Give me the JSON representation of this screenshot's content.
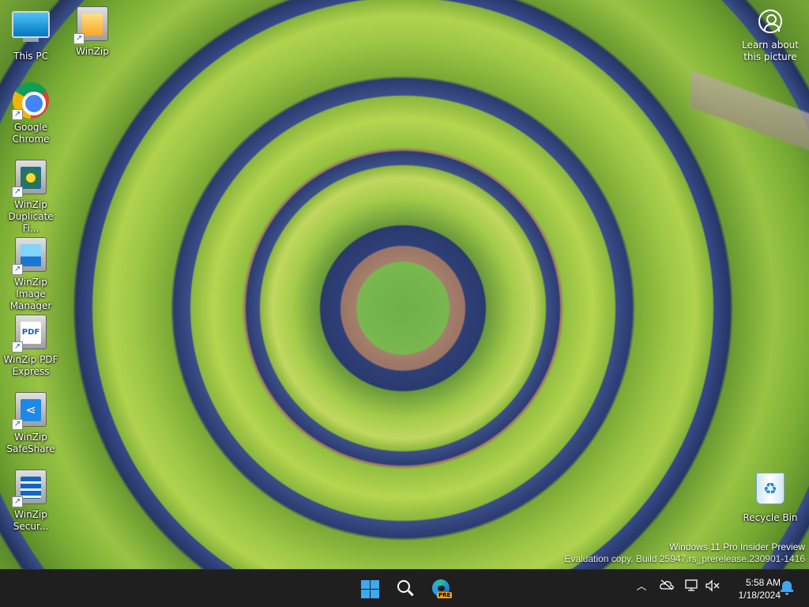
{
  "desktop": {
    "icons": [
      {
        "label": "This PC",
        "icon": "this-pc-icon"
      },
      {
        "label": "WinZip",
        "icon": "winzip-icon"
      },
      {
        "label": "Google Chrome",
        "icon": "chrome-icon"
      },
      {
        "label": "WinZip Duplicate Fi...",
        "icon": "winzip-duplicate-finder-icon"
      },
      {
        "label": "WinZip Image Manager",
        "icon": "winzip-image-manager-icon"
      },
      {
        "label": "WinZip PDF Express",
        "icon": "winzip-pdf-express-icon"
      },
      {
        "label": "WinZip SafeShare",
        "icon": "winzip-safeshare-icon"
      },
      {
        "label": "WinZip Secur...",
        "icon": "winzip-secure-backup-icon"
      },
      {
        "label": "Recycle Bin",
        "icon": "recycle-bin-icon"
      }
    ],
    "learn_about": {
      "line1": "Learn about",
      "line2": "this picture"
    },
    "watermark": {
      "line1": "Windows 11 Pro Insider Preview",
      "line2": "Evaluation copy. Build 25947.rs_prerelease.230901-1416"
    }
  },
  "taskbar": {
    "pinned": [
      {
        "name": "Start",
        "icon": "windows-start-icon"
      },
      {
        "name": "Search",
        "icon": "search-icon"
      },
      {
        "name": "Microsoft Edge",
        "icon": "edge-icon",
        "badge": "PRE"
      }
    ],
    "tray": {
      "overflow_icon": "chevron-up-icon",
      "icons": [
        "onedrive-icon",
        "network-icon",
        "volume-muted-icon"
      ],
      "time": "5:58 AM",
      "date": "1/18/2024",
      "notification_icon": "bell-icon"
    }
  },
  "colors": {
    "taskbar_bg": "#1f1f1f",
    "accent": "#3ea8f0"
  }
}
